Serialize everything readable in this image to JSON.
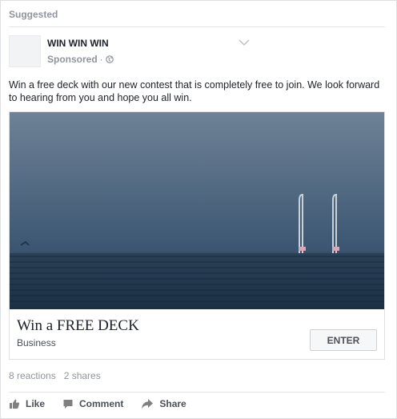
{
  "header": {
    "label": "Suggested"
  },
  "post": {
    "page_name": "WIN WIN WIN",
    "sponsored": "Sponsored",
    "separator": "·",
    "text": "Win a free deck with our new contest that is completely free to join. We look forward to hearing from you and hope you all win."
  },
  "ad": {
    "title": "Win a FREE DECK",
    "domain": "Business",
    "cta_label": "ENTER"
  },
  "stats": {
    "reactions": "8 reactions",
    "shares": "2 shares"
  },
  "actions": {
    "like": "Like",
    "comment": "Comment",
    "share": "Share"
  },
  "icons": {
    "options": "chevron-down-icon",
    "audience": "globe-icon",
    "like": "thumbs-up-icon",
    "comment": "comment-icon",
    "share": "share-arrow-icon"
  },
  "colors": {
    "meta_text": "#90949c",
    "action_text": "#4b4f56",
    "body_text": "#1d2129",
    "sky_top": "#6f8296",
    "sea_dark": "#1f3448"
  }
}
